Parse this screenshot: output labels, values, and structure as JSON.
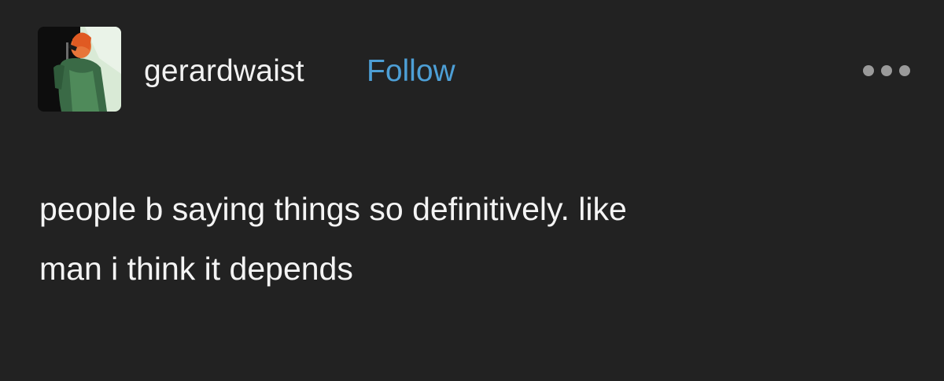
{
  "post": {
    "username": "gerardwaist",
    "follow_label": "Follow",
    "more_icon": "more-horizontal-icon",
    "avatar_icon": "avatar-photo",
    "text_lines": [
      "people b saying things so definitively. like",
      "man i think it depends"
    ]
  },
  "colors": {
    "background": "#222222",
    "text": "#f4f4f4",
    "follow": "#4d9fd6",
    "more_dots": "#9a9a9a"
  }
}
